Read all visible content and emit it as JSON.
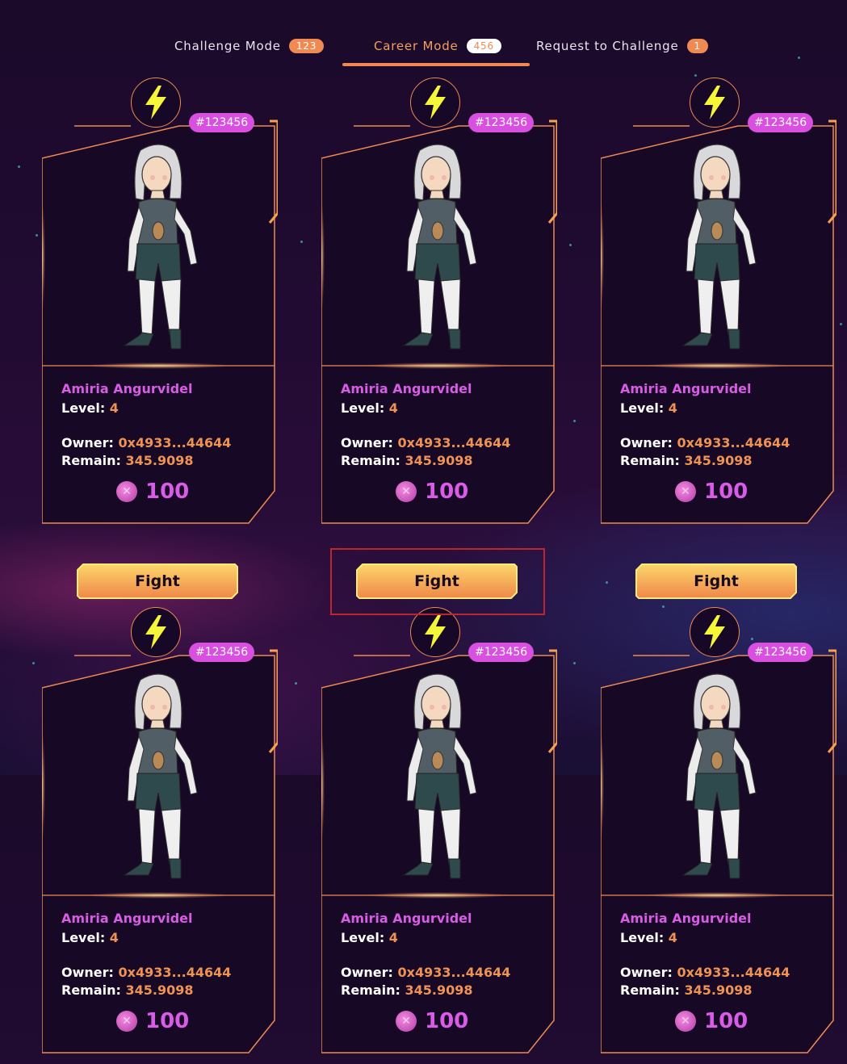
{
  "tabs": [
    {
      "label": "Challenge Mode",
      "count": "123"
    },
    {
      "label": "Career Mode",
      "count": "456"
    },
    {
      "label": "Request to Challenge",
      "count": "1"
    }
  ],
  "active_tab": "Career Mode",
  "fighter": {
    "token_id": "#123456",
    "name": "Amiria Angurvidel",
    "level_label": "Level:",
    "level": "4",
    "owner_label": "Owner:",
    "owner": "0x4933...44644",
    "remain_label": "Remain:",
    "remain": "345.9098",
    "price": "100",
    "fight_label": "Fight"
  },
  "colors": {
    "accent_orange": "#ef8a52",
    "accent_pink": "#d85ce6",
    "bolt_yellow": "#f5f53a",
    "highlight_red": "#b8282e"
  },
  "icons": [
    "lightning-bolt-icon",
    "token-coin-icon"
  ]
}
